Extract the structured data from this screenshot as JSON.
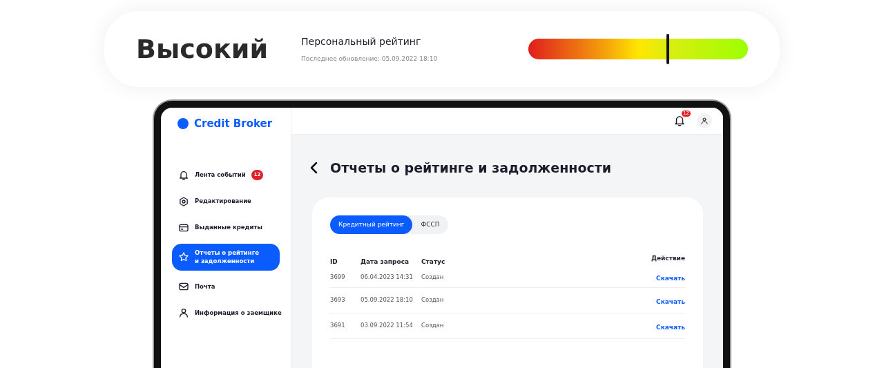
{
  "rating": {
    "label": "Высокий",
    "title": "Персональный рейтинг",
    "updated": "Последнее обновление: 05.09.2022 18:10",
    "level": 0.635
  },
  "app": {
    "logo": "Credit Broker",
    "notifications": "12",
    "sidebar": {
      "items": [
        {
          "label": "Лента событий",
          "badge": "12",
          "selected": false
        },
        {
          "label": "Редактирование",
          "selected": false
        },
        {
          "label": "Выданные кредиты",
          "selected": false
        },
        {
          "label": "Отчеты о рейтинге и задолженности",
          "selected": true
        },
        {
          "label": "Почта",
          "selected": false
        },
        {
          "label": "Информация о заемщике",
          "selected": false
        }
      ]
    },
    "page_title": "Отчеты о рейтинге и задолженности",
    "tabs": [
      {
        "label": "Кредитный рейтинг",
        "selected": true
      },
      {
        "label": "ФССП",
        "selected": false
      }
    ],
    "table": {
      "columns": [
        "ID",
        "Дата запроса",
        "Статус",
        "Действие"
      ],
      "rows": [
        {
          "id": "3699",
          "date": "06.04.2023 14:31",
          "status": "Создан",
          "action": "Скачать"
        },
        {
          "id": "3693",
          "date": "05.09.2022 18:10",
          "status": "Создан",
          "action": "Скачать"
        },
        {
          "id": "3691",
          "date": "03.09.2022 11:54",
          "status": "Создан",
          "action": "Скачать"
        }
      ]
    }
  }
}
